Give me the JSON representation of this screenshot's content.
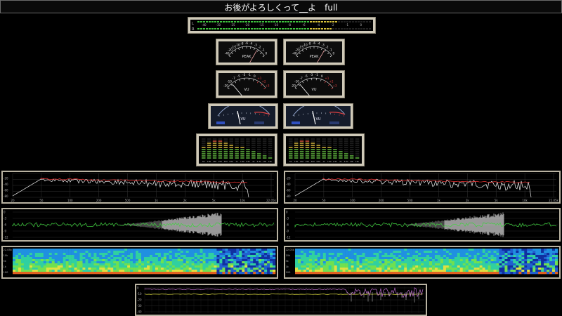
{
  "window": {
    "title": "お後がよろしくって__よ　full"
  },
  "level_meter": {
    "channels": [
      "L",
      "R"
    ],
    "scale": [
      "-40",
      "-30",
      "-25",
      "-20",
      "-15",
      "-10",
      "-8",
      "-6",
      "-4",
      "-2",
      "-1",
      "0"
    ]
  },
  "peak_meters": {
    "left": {
      "label": "PEAK",
      "scale": [
        "-40",
        "-20",
        "-15",
        "-10",
        "-8",
        "-6",
        "-4",
        "-3",
        "-2",
        "-1",
        "0"
      ]
    },
    "right": {
      "label": "PEAK",
      "scale": [
        "-40",
        "-20",
        "-15",
        "-10",
        "-8",
        "-6",
        "-4",
        "-3",
        "-2",
        "-1",
        "0"
      ]
    }
  },
  "vu_meters": {
    "left": {
      "label": "VU",
      "scale": [
        "-20",
        "-10",
        "-7",
        "-5",
        "-3",
        "-1",
        "0",
        "+1",
        "+2",
        "+3"
      ]
    },
    "right": {
      "label": "VU",
      "scale": [
        "-20",
        "-10",
        "-7",
        "-5",
        "-3",
        "-1",
        "0",
        "+1",
        "+2",
        "+3"
      ]
    }
  },
  "vu_meters_2": {
    "left": {
      "label": "VU"
    },
    "right": {
      "label": "VU"
    }
  },
  "octave_bands": [
    "50",
    "100",
    "160",
    "250",
    "400",
    "630",
    "1k",
    "1.6k",
    "2.5k",
    "4k",
    "6.3k",
    "10k",
    "16k"
  ],
  "spectrum": {
    "y_labels": [
      "-20",
      "-40",
      "-60",
      "-80"
    ],
    "x_labels": [
      "20",
      "50",
      "100",
      "200",
      "500",
      "1k",
      "2k",
      "5k",
      "10k",
      "22.05k"
    ]
  },
  "waveform": {
    "y_labels": [
      "0",
      "-3",
      "-6",
      "-9",
      "-12"
    ]
  },
  "spectrogram": {
    "y_labels": [
      "22.05k",
      "10k",
      "5k",
      "1k",
      "100"
    ]
  },
  "loudness": {
    "y_labels": [
      "0",
      "-10",
      "-20",
      "-30",
      "-40"
    ]
  },
  "colors": {
    "frame": "#cfc9b8",
    "meter_green": "#3fc43f",
    "meter_yellow": "#d8c23a",
    "spectrum_red": "#e03030",
    "wave_green": "#3ed13e",
    "loud_pink": "#c070d0",
    "loud_yellow": "#d8d83a"
  }
}
